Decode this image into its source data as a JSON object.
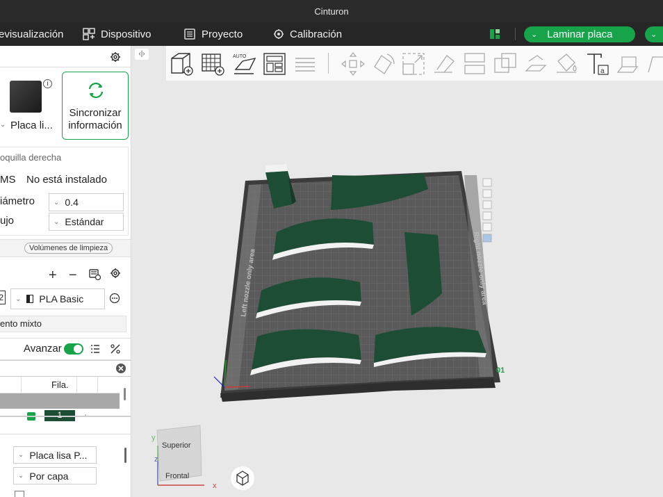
{
  "window": {
    "title": "Cinturon"
  },
  "menu": {
    "preview": "evisualización",
    "device": "Dispositivo",
    "project": "Proyecto",
    "calibration": "Calibración",
    "slice": "Laminar placa"
  },
  "printer": {
    "plate_name": "Placa li...",
    "sync": [
      "Sincronizar",
      "información"
    ]
  },
  "nozzle": {
    "header": "oquilla derecha",
    "ams_label": "MS",
    "ams_value": "No está instalado",
    "diameter_label": "iámetro",
    "diameter_value": "0.4",
    "flow_label": "ujo",
    "flow_value": "Estándar"
  },
  "flush_button": "Volúmenes de limpieza",
  "filament": {
    "slot": "2",
    "name": "PLA Basic",
    "mixed": "ento mixto"
  },
  "process": {
    "advance_label": "Avanzar",
    "advance_on": true
  },
  "objects_table": {
    "col_row": "Fila.",
    "first_value": "1"
  },
  "plate_settings": {
    "plate_type": "Placa lisa P...",
    "sequence": "Por capa"
  },
  "bed": {
    "left_area": "Left nozzle only area",
    "right_area": "Right nozzle only area",
    "plate_number": "01"
  },
  "view_cube": {
    "top": "Superior",
    "front": "Frontal",
    "axis_x": "x",
    "axis_y": "y",
    "axis_z": "z"
  },
  "colors": {
    "accent": "#16a34a",
    "model": "#1e4d35",
    "bed": "#4a4a4a"
  }
}
